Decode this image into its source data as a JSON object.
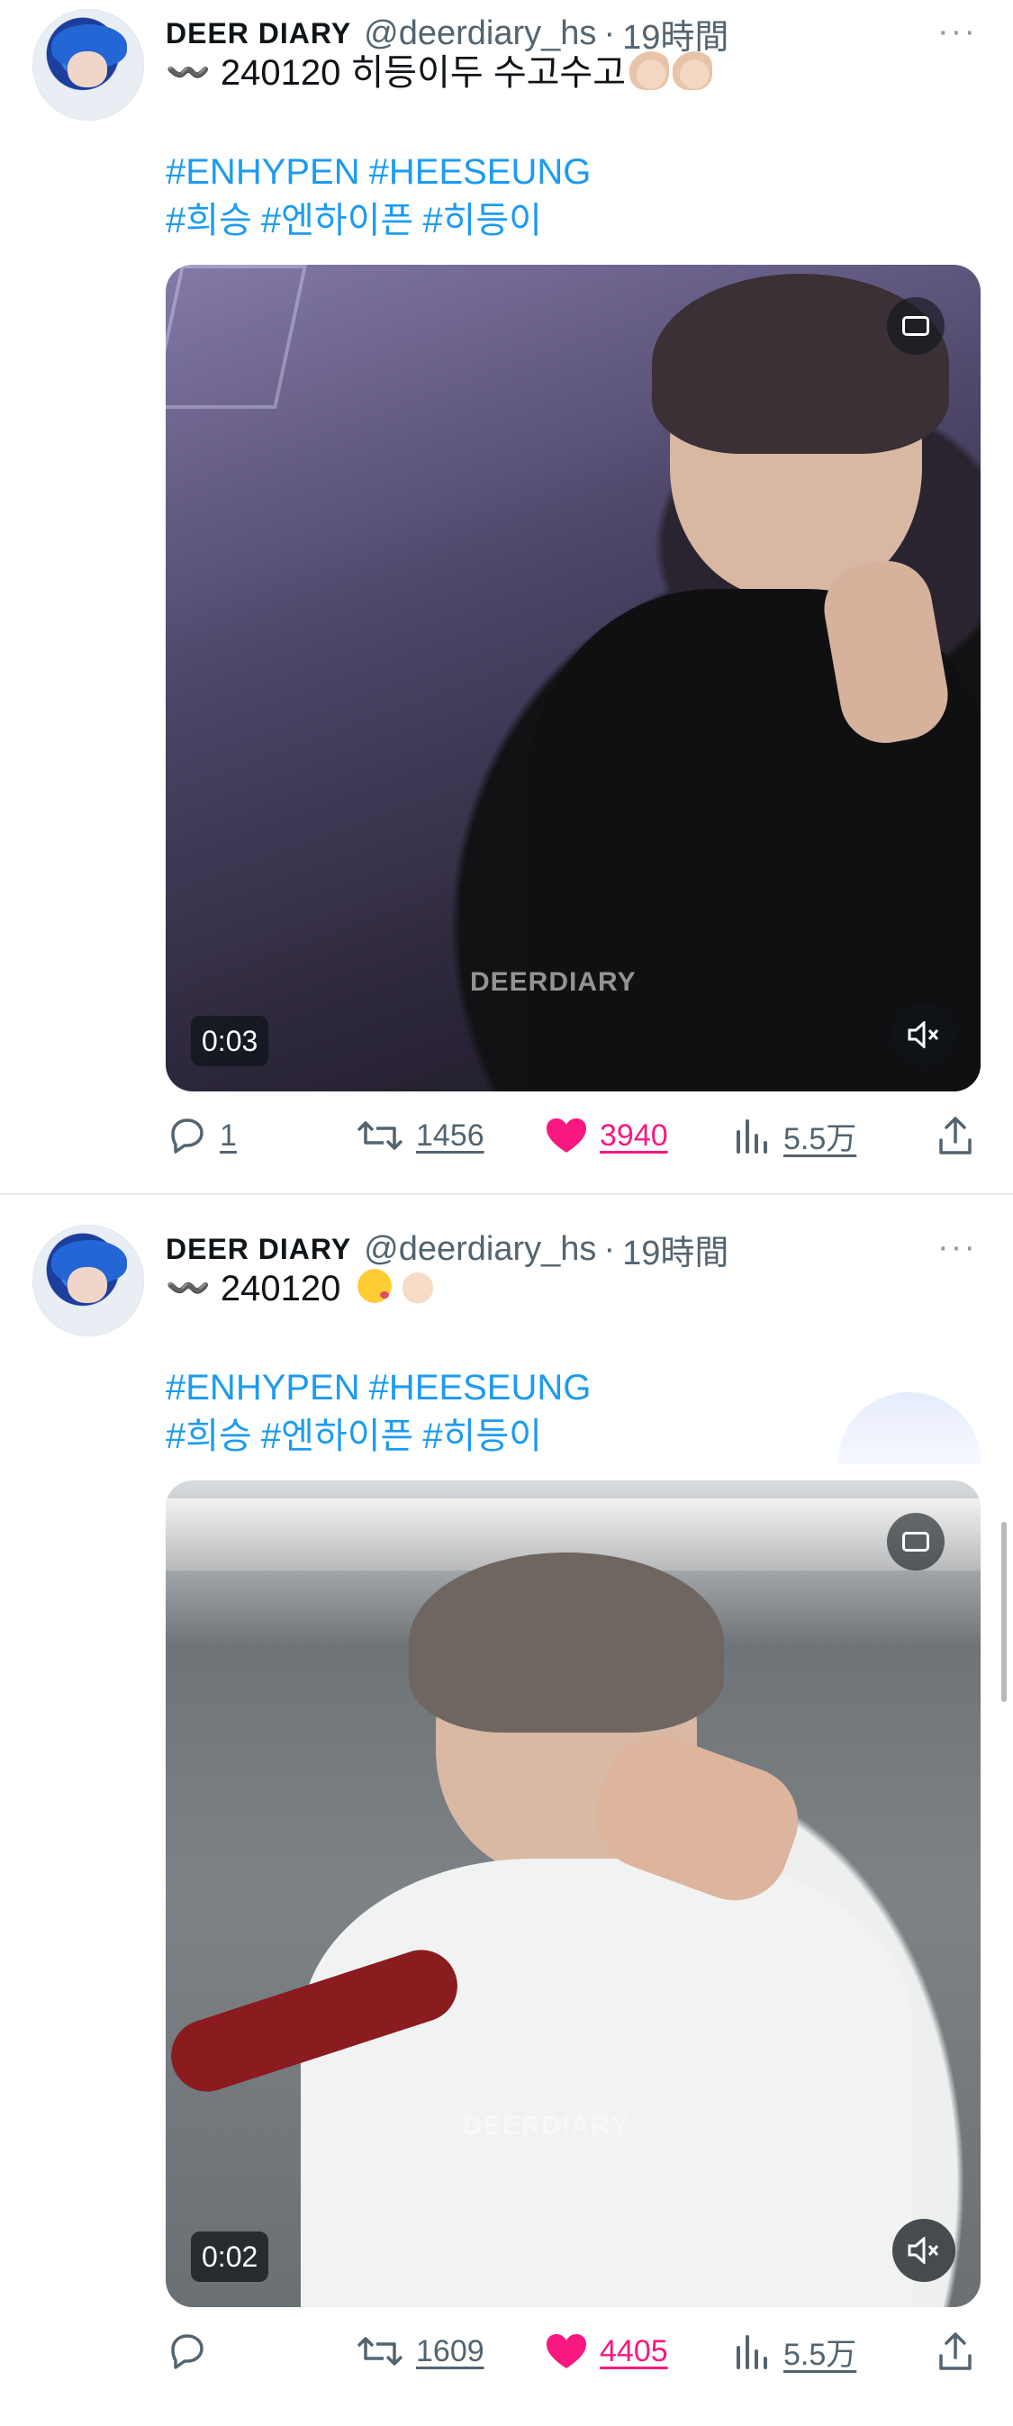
{
  "tweets": [
    {
      "author_name": "DEER DIARY",
      "handle": "@deerdiary_hs",
      "separator": "·",
      "time": "19時間",
      "text": "〰️ 240120 히등이두 수고수고",
      "emojis": [
        "thumbs-up",
        "thumbs-up"
      ],
      "hashtags_line1": [
        "#ENHYPEN",
        "#HEESEUNG"
      ],
      "hashtags_line2": [
        "#희승",
        "#엔하이픈",
        "#히등이"
      ],
      "video": {
        "duration": "0:03",
        "watermark": "DEERDIARY"
      },
      "stats": {
        "replies": "1",
        "retweets": "1456",
        "likes": "3940",
        "views": "5.5万"
      }
    },
    {
      "author_name": "DEER DIARY",
      "handle": "@deerdiary_hs",
      "separator": "·",
      "time": "19時間",
      "text": "〰️ 240120",
      "emojis": [
        "face-blowing-kiss",
        "waving-hand"
      ],
      "hashtags_line1": [
        "#ENHYPEN",
        "#HEESEUNG"
      ],
      "hashtags_line2": [
        "#희승",
        "#엔하이픈",
        "#히등이"
      ],
      "video": {
        "duration": "0:02",
        "watermark": "DEERDIARY"
      },
      "stats": {
        "replies": "",
        "retweets": "1609",
        "likes": "4405",
        "views": "5.5万"
      }
    }
  ],
  "more_icon": "···",
  "colors": {
    "link": "#1d9bf0",
    "like": "#f91880",
    "secondary_text": "#536471"
  }
}
